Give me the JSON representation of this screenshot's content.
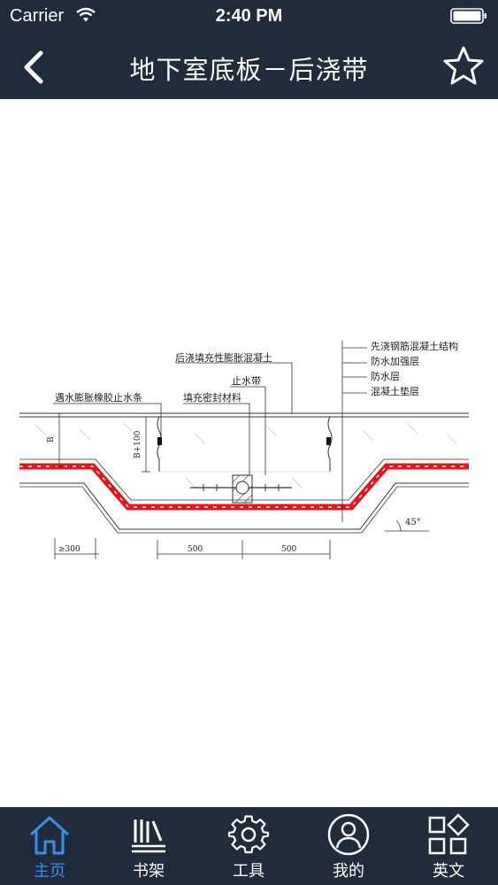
{
  "status_bar": {
    "carrier": "Carrier",
    "time": "2:40 PM"
  },
  "nav": {
    "title": "地下室底板－后浇带"
  },
  "drawing": {
    "labels": {
      "post_cast_concrete": "后浇填充性膨胀混凝土",
      "waterstop": "止水带",
      "sealant": "填充密封材料",
      "swelling_strip": "遇水膨胀橡胶止水条",
      "first_cast": "先浇钢筋混凝土结构",
      "waterproof_reinforce": "防水加强层",
      "waterproof": "防水层",
      "cushion": "混凝土垫层",
      "dim_b": "B",
      "dim_b100": "B+100",
      "dim_300": "≥300",
      "dim_500_left": "500",
      "dim_500_right": "500",
      "angle": "45°"
    },
    "colors": {
      "waterproof_layer": "#e3141b",
      "lines": "#333333"
    }
  },
  "tabbar": {
    "tabs": [
      {
        "label": "主页",
        "icon": "home-icon",
        "active": true
      },
      {
        "label": "书架",
        "icon": "bookshelf-icon",
        "active": false
      },
      {
        "label": "工具",
        "icon": "gear-icon",
        "active": false
      },
      {
        "label": "我的",
        "icon": "user-icon",
        "active": false
      },
      {
        "label": "英文",
        "icon": "grid-icon",
        "active": false
      }
    ]
  },
  "colors": {
    "header_bg": "#202c3c",
    "active_tab": "#3a8ee6"
  }
}
